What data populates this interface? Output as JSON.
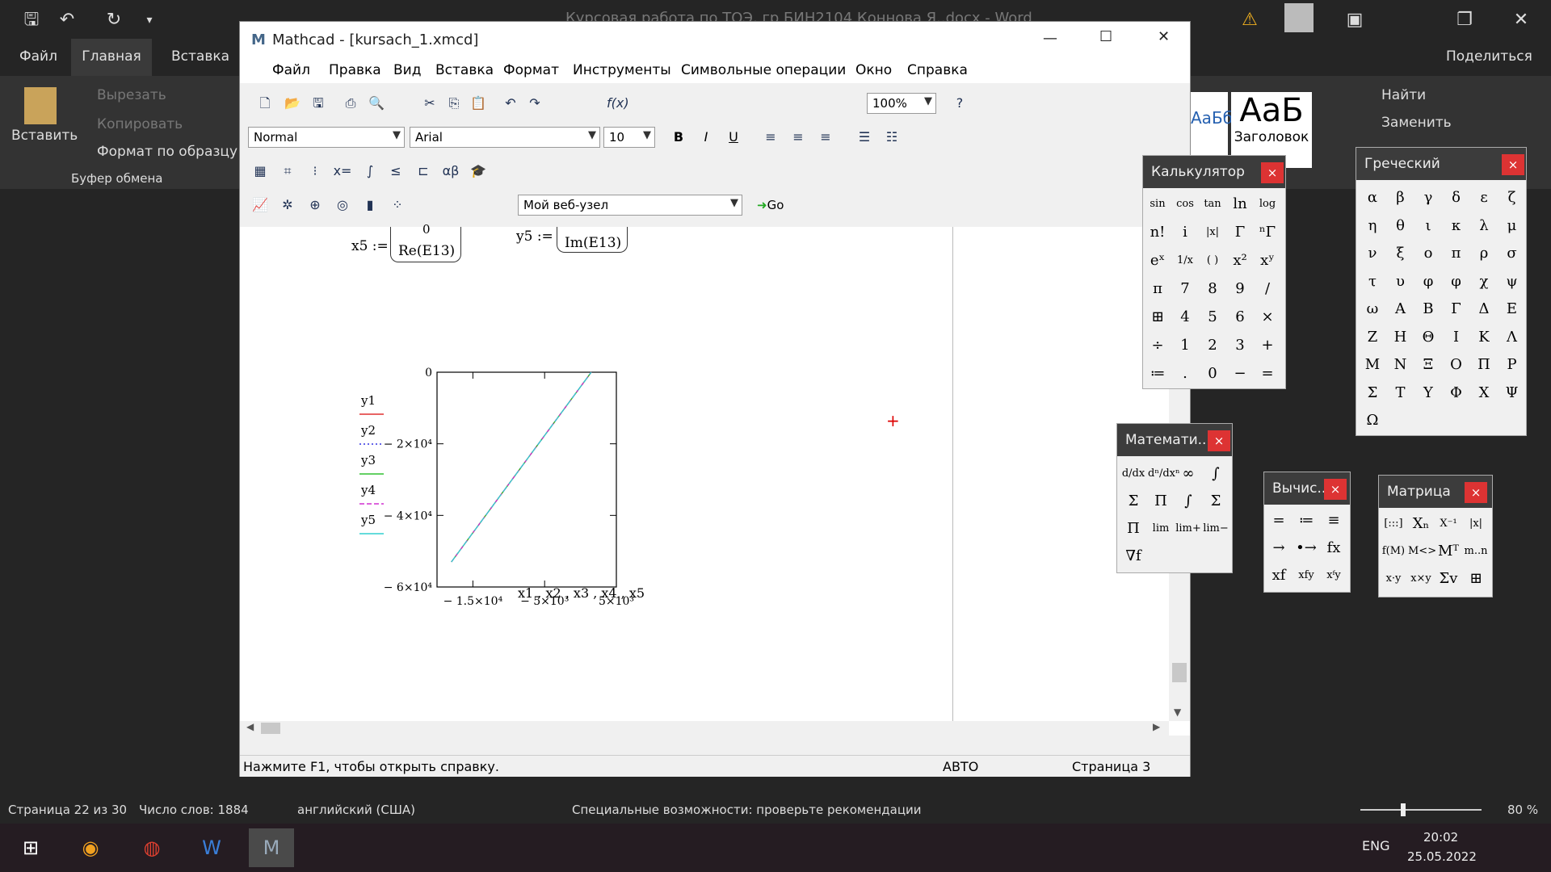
{
  "word": {
    "title": "Курсовая работа по ТОЭ, гр БИН2104 Коннова Я..docx - Word",
    "tabs": [
      "Файл",
      "Главная",
      "Вставка"
    ],
    "share": "Поделиться",
    "clipboard": {
      "paste": "Вставить",
      "cut": "Вырезать",
      "copy": "Копировать",
      "format_painter": "Формат по образцу",
      "group": "Буфер обмена"
    },
    "styles": [
      "АаБбВвГ",
      "АаБ",
      "Заголовок"
    ],
    "editing": {
      "find": "Найти",
      "replace": "Заменить"
    },
    "status": {
      "page": "Страница 22 из 30",
      "words": "Число слов: 1884",
      "lang": "английский (США)",
      "accessibility": "Специальные возможности: проверьте рекомендации",
      "zoom": "80 %"
    }
  },
  "taskbar": {
    "lang": "ENG",
    "time": "20:02",
    "date": "25.05.2022"
  },
  "mathcad": {
    "title": "Mathcad - [kursach_1.xmcd]",
    "menu": [
      "Файл",
      "Правка",
      "Вид",
      "Вставка",
      "Формат",
      "Инструменты",
      "Символьные операции",
      "Окно",
      "Справка"
    ],
    "zoom": "100%",
    "style": "Normal",
    "font": "Arial",
    "size": "10",
    "web": "Мой веб-узел",
    "go": "Go",
    "status": {
      "help": "Нажмите F1, чтобы открыть справку.",
      "mode": "АВТО",
      "page": "Страница 3"
    },
    "math": {
      "x5_lhs": "x5 :=",
      "x5_top": "0",
      "x5_bottom": "Re(E13)",
      "y5_lhs": "y5 :=",
      "y5_bottom": "Im(E13)"
    }
  },
  "chart_data": {
    "type": "line",
    "xlabel": "x1 , x2 , x3 , x4 , x5",
    "xticks": [
      "− 1.5×10⁴",
      "− 5×10³",
      "5×10³"
    ],
    "yticks": [
      "0",
      "− 2×10⁴",
      "− 4×10⁴",
      "− 6×10⁴"
    ],
    "xlim": [
      -20000,
      5000
    ],
    "ylim": [
      -60000,
      0
    ],
    "series": [
      {
        "name": "y1",
        "color": "#e03030",
        "style": "solid"
      },
      {
        "name": "y2",
        "color": "#3030e0",
        "style": "dotted"
      },
      {
        "name": "y3",
        "color": "#30c030",
        "style": "solid"
      },
      {
        "name": "y4",
        "color": "#d030d0",
        "style": "dashed"
      },
      {
        "name": "y5",
        "color": "#30d0d0",
        "style": "solid"
      }
    ],
    "line_points": [
      [
        -18000,
        -53000
      ],
      [
        1500,
        0
      ]
    ]
  },
  "palettes": {
    "calc": {
      "title": "Калькулятор",
      "keys": [
        "sin",
        "cos",
        "tan",
        "ln",
        "log",
        "n!",
        "i",
        "|x|",
        "Γ",
        "ⁿΓ",
        "eˣ",
        "1/x",
        "( )",
        "x²",
        "xʸ",
        "π",
        "7",
        "8",
        "9",
        "/",
        "⊞",
        "4",
        "5",
        "6",
        "×",
        "÷",
        "1",
        "2",
        "3",
        "+",
        "≔",
        ".",
        "0",
        "−",
        "="
      ]
    },
    "greek": {
      "title": "Греческий",
      "keys": [
        "α",
        "β",
        "γ",
        "δ",
        "ε",
        "ζ",
        "η",
        "θ",
        "ι",
        "κ",
        "λ",
        "μ",
        "ν",
        "ξ",
        "ο",
        "π",
        "ρ",
        "σ",
        "τ",
        "υ",
        "φ",
        "φ",
        "χ",
        "ψ",
        "ω",
        "Α",
        "Β",
        "Γ",
        "Δ",
        "Ε",
        "Ζ",
        "Η",
        "Θ",
        "Ι",
        "Κ",
        "Λ",
        "Μ",
        "Ν",
        "Ξ",
        "Ο",
        "Π",
        "Ρ",
        "Σ",
        "Τ",
        "Υ",
        "Φ",
        "Χ",
        "Ψ",
        "Ω"
      ]
    },
    "calculus": {
      "title": "Математи...",
      "keys": [
        "d/dx",
        "dⁿ/dxⁿ",
        "∞",
        "∫",
        "Σ",
        "Π",
        "∫",
        "Σ",
        "Π",
        "lim",
        "lim+",
        "lim−",
        "∇f"
      ]
    },
    "eval": {
      "title": "Вычис...",
      "keys": [
        "=",
        "≔",
        "≡",
        "→",
        "•→",
        "fx",
        "xf",
        "xfy",
        "xᶠy"
      ]
    },
    "matrix": {
      "title": "Матрица",
      "keys": [
        "[:::]",
        "Xₙ",
        "X⁻¹",
        "|x|",
        "f(M)",
        "M<>",
        "Mᵀ",
        "m..n",
        "x·y",
        "x×y",
        "Σv",
        "⊞"
      ]
    }
  }
}
